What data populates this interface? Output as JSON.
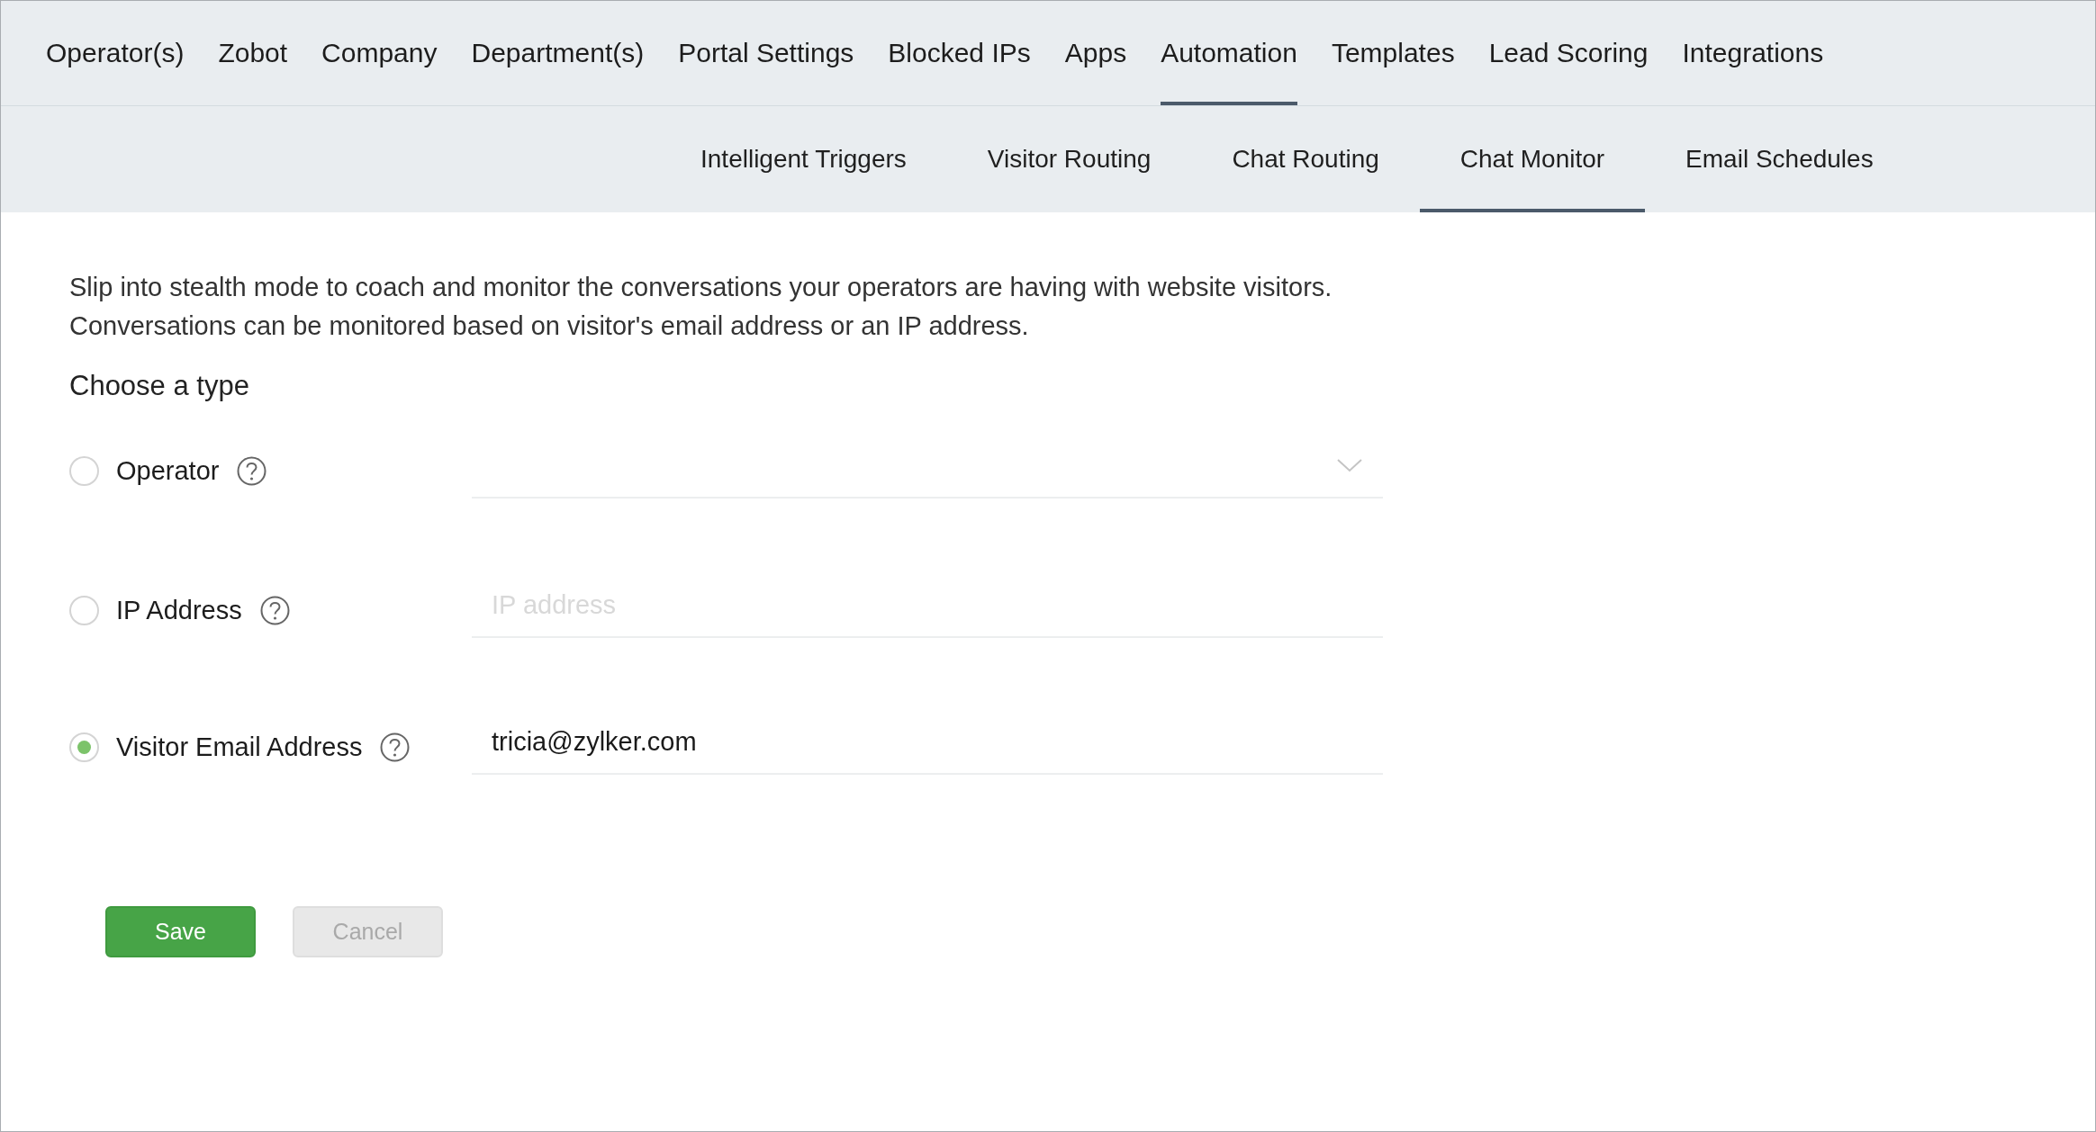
{
  "nav_tabs": [
    {
      "label": "Operator(s)",
      "selected": false
    },
    {
      "label": "Zobot",
      "selected": false
    },
    {
      "label": "Company",
      "selected": false
    },
    {
      "label": "Department(s)",
      "selected": false
    },
    {
      "label": "Portal Settings",
      "selected": false
    },
    {
      "label": "Blocked IPs",
      "selected": false
    },
    {
      "label": "Apps",
      "selected": false
    },
    {
      "label": "Automation",
      "selected": true
    },
    {
      "label": "Templates",
      "selected": false
    },
    {
      "label": "Lead Scoring",
      "selected": false
    },
    {
      "label": "Integrations",
      "selected": false
    }
  ],
  "sub_tabs": [
    {
      "label": "Intelligent Triggers",
      "selected": false
    },
    {
      "label": "Visitor Routing",
      "selected": false
    },
    {
      "label": "Chat Routing",
      "selected": false
    },
    {
      "label": "Chat Monitor",
      "selected": true
    },
    {
      "label": "Email Schedules",
      "selected": false
    }
  ],
  "description": [
    "Slip into stealth mode to coach and monitor the conversations your operators are having with website visitors.",
    "Conversations can be monitored based on visitor's email address or an IP address."
  ],
  "heading": "Choose a type",
  "options": [
    {
      "label": "Operator",
      "selected": false,
      "kind": "select"
    },
    {
      "label": "IP Address",
      "selected": false,
      "kind": "text",
      "placeholder": "IP address"
    },
    {
      "label": "Visitor Email Address",
      "selected": true,
      "kind": "text",
      "value": "tricia@zylker.com"
    }
  ],
  "buttons": [
    {
      "label": "Save",
      "kind": "primary",
      "disabled": false
    },
    {
      "label": "Cancel",
      "kind": "secondary",
      "disabled": true
    }
  ]
}
